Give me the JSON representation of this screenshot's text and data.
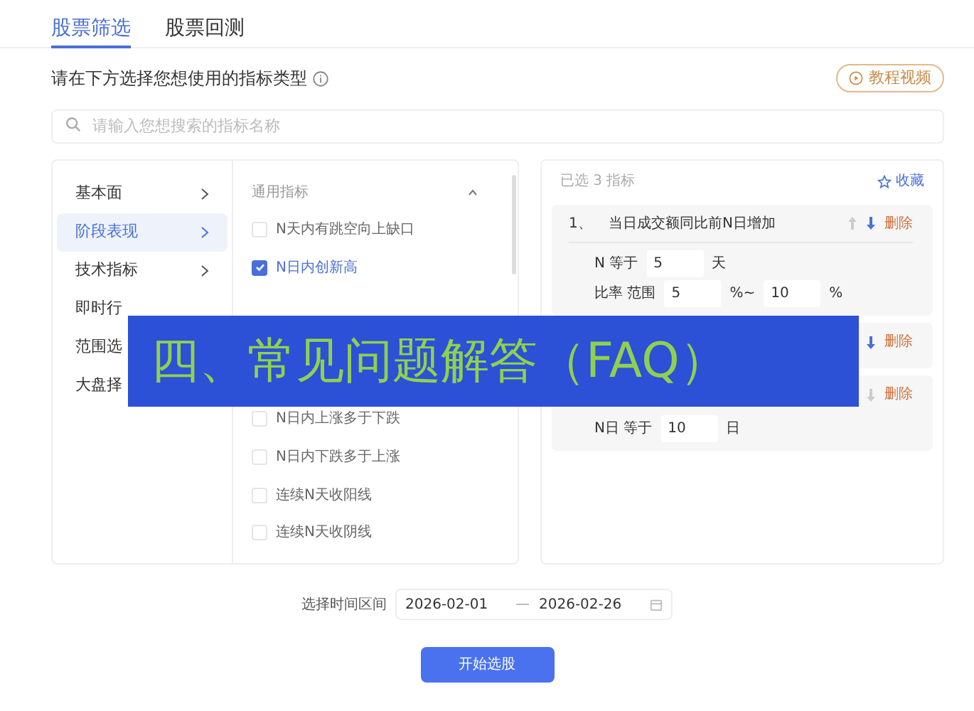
{
  "tabs": [
    {
      "label": "股票筛选",
      "selected": true
    },
    {
      "label": "股票回测",
      "selected": false
    }
  ],
  "prompt": "请在下方选择您想使用的指标类型",
  "tutorial_button": "教程视频",
  "search": {
    "placeholder": "请输入您想搜索的指标名称"
  },
  "categories": [
    {
      "label": "基本面",
      "selected": false,
      "has_submenu": true
    },
    {
      "label": "阶段表现",
      "selected": true,
      "has_submenu": true
    },
    {
      "label": "技术指标",
      "selected": false,
      "has_submenu": true
    },
    {
      "label": "即时行",
      "selected": false
    },
    {
      "label": "范围选",
      "selected": false
    },
    {
      "label": "大盘择",
      "selected": false
    }
  ],
  "indicator_group": {
    "title": "通用指标",
    "expanded": true,
    "items": [
      {
        "label": "N天内有跳空向上缺口",
        "checked": false
      },
      {
        "label": "N日内创新高",
        "checked": true
      },
      {
        "label": "N日内上涨多于下跌",
        "checked": false
      },
      {
        "label": "N日内下跌多于上涨",
        "checked": false
      },
      {
        "label": "连续N天收阳线",
        "checked": false
      },
      {
        "label": "连续N天收阴线",
        "checked": false
      }
    ]
  },
  "selected_panel": {
    "count_prefix": "已选",
    "count": "3",
    "count_suffix": "指标",
    "favorite_button": "收藏",
    "cards": [
      {
        "index": "1、",
        "title": "当日成交额同比前N日增加",
        "up_disabled": true,
        "down_disabled": false,
        "delete": "删除",
        "rows": [
          [
            {
              "kind": "text",
              "text": "N 等于"
            },
            {
              "kind": "input",
              "value": "5"
            },
            {
              "kind": "text",
              "text": "天"
            }
          ],
          [
            {
              "kind": "text",
              "text": "比率 范围"
            },
            {
              "kind": "input",
              "value": "5"
            },
            {
              "kind": "text",
              "text": "%~"
            },
            {
              "kind": "input",
              "value": "10"
            },
            {
              "kind": "text",
              "text": "%"
            }
          ]
        ]
      },
      {
        "down_disabled": false,
        "delete": "删除"
      },
      {
        "down_disabled": true,
        "delete": "删除",
        "rows": [
          [
            {
              "kind": "text",
              "text": "N日 等于"
            },
            {
              "kind": "input",
              "value": "10"
            },
            {
              "kind": "text",
              "text": "日"
            }
          ]
        ]
      }
    ]
  },
  "date_range": {
    "label": "选择时间区间",
    "start": "2026-02-01",
    "end": "2026-02-26"
  },
  "start_button": "开始选股",
  "banner": "四、常见问题解答（FAQ）"
}
